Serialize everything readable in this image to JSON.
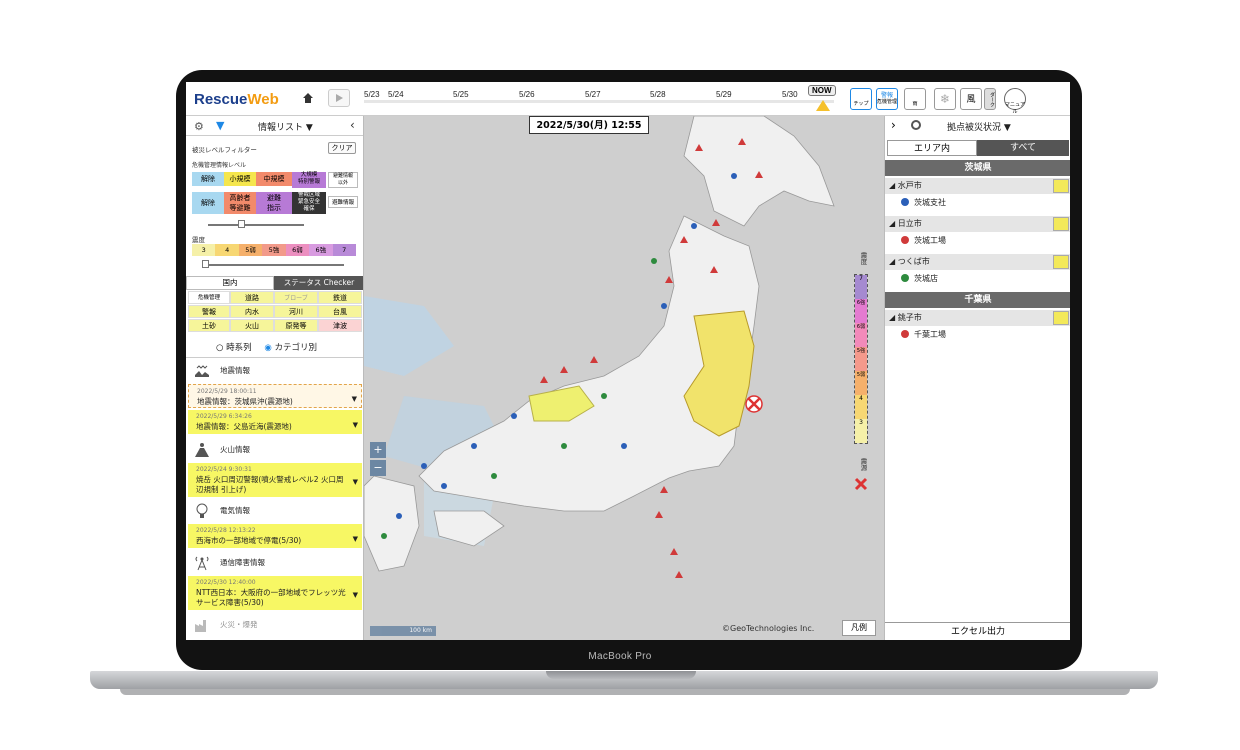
{
  "device": {
    "model_label": "MacBook Pro"
  },
  "app": {
    "logo_main": "Rescue",
    "logo_accent": "Web"
  },
  "timeline": {
    "dates": [
      "5/23",
      "5/24",
      "5/25",
      "5/26",
      "5/27",
      "5/28",
      "5/29",
      "5/30"
    ],
    "now_label": "NOW"
  },
  "toolbar": {
    "chip_label": "チップ",
    "alert_label_top": "警報",
    "alert_label_bottom": "危機管理",
    "rain_label": "雨",
    "wind_label": "風",
    "dark_label": "ダーク",
    "manual_label": "マニュアル"
  },
  "left_panel": {
    "title": "情報リスト ▼",
    "damage_filter_label": "被災レベルフィルター",
    "crisis_level_label": "危機管理情報レベル",
    "clear_button": "クリア",
    "level_row1": [
      "解除",
      "小規模",
      "中規模",
      "大規模\n特別警報",
      "避難情報\n以外"
    ],
    "level_row2": [
      "解除",
      "高齢者\n等避難",
      "避難\n指示",
      "警戒区域\n緊急安全\n確保",
      "避難情報"
    ],
    "intensity_label": "震度",
    "intensity_scale": [
      "3",
      "4",
      "5弱",
      "5強",
      "6弱",
      "6強",
      "7"
    ],
    "tab_domestic": "国内",
    "tab_status": "ステータス Checker",
    "category_grid": [
      [
        "危機管理",
        "道路",
        "ブローブ",
        "鉄道"
      ],
      [
        "警報",
        "内水",
        "河川",
        "台風"
      ],
      [
        "土砂",
        "火山",
        "原発等",
        "津波"
      ]
    ],
    "radio_timeseries": "時系列",
    "radio_category": "カテゴリ別",
    "categories": [
      {
        "title": "地震情報",
        "icon": "earthquake-icon",
        "items": [
          {
            "time": "2022/5/29 18:00:11",
            "text": "地震情報：茨城県沖(震源地)"
          },
          {
            "time": "2022/5/29 6:34:26",
            "text": "地震情報：父島近海(震源地)"
          }
        ]
      },
      {
        "title": "火山情報",
        "icon": "volcano-icon",
        "items": [
          {
            "time": "2022/5/24 9:30:31",
            "text": "焼岳 火口周辺警報(噴火警戒レベル2 火口周辺規制 引上げ)"
          }
        ]
      },
      {
        "title": "電気情報",
        "icon": "bulb-icon",
        "items": [
          {
            "time": "2022/5/28 12:13:22",
            "text": "西海市の一部地域で停電(5/30)"
          }
        ]
      },
      {
        "title": "通信障害情報",
        "icon": "antenna-icon",
        "items": [
          {
            "time": "2022/5/30 12:40:00",
            "text": "NTT西日本：大阪府の一部地域でフレッツ光サービス障害(5/30)"
          }
        ]
      },
      {
        "title": "火災・爆発",
        "icon": "factory-icon",
        "items": []
      }
    ]
  },
  "map": {
    "datetime": "2022/5/30(月)  12:55",
    "copyright": "©GeoTechnologies Inc.",
    "legend_button": "凡例",
    "scale_label": "100 km",
    "intensity_side_label": "震度",
    "intensity_side_values": [
      "7",
      "6強",
      "6弱",
      "5強",
      "5弱",
      "4",
      "3"
    ],
    "epicenter_label": "震源"
  },
  "right_panel": {
    "title": "拠点被災状況 ▼",
    "tab_area": "エリア内",
    "tab_all": "すべて",
    "groups": [
      {
        "prefecture": "茨城県",
        "cities": [
          {
            "name": "水戸市",
            "sites": [
              {
                "name": "茨城支社",
                "color": "#2b5fb8"
              }
            ]
          },
          {
            "name": "日立市",
            "sites": [
              {
                "name": "茨城工場",
                "color": "#d03a3a"
              }
            ]
          },
          {
            "name": "つくば市",
            "sites": [
              {
                "name": "茨城店",
                "color": "#2e8b3e"
              }
            ]
          }
        ]
      },
      {
        "prefecture": "千葉県",
        "cities": [
          {
            "name": "銚子市",
            "sites": [
              {
                "name": "千葉工場",
                "color": "#d03a3a"
              }
            ]
          }
        ]
      }
    ],
    "excel_button": "エクセル出力"
  }
}
